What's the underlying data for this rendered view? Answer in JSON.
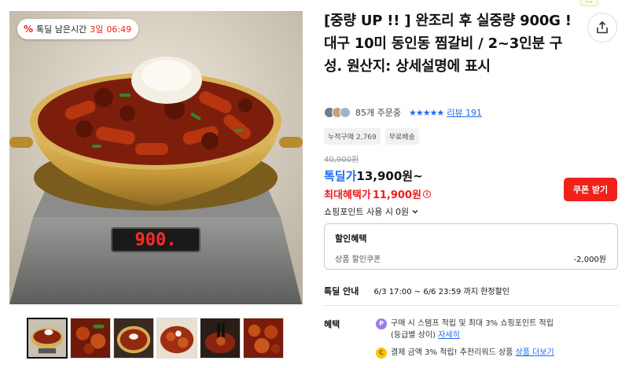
{
  "gallery": {
    "timer": {
      "prefix": "톡딜 남은시간",
      "days": "3일",
      "time": "06:49"
    },
    "scale_display": "900.",
    "thumbnail_count": 6
  },
  "header": {
    "corner_badge": "…"
  },
  "product": {
    "title": "[중량 UP !! ] 완조리 후 실중량 900G ! 대구 10미 동인동 찜갈비 / 2~3인분 구성. 원산지: 상세설명에 표시",
    "order_count": "85개 주문중",
    "stars": "★★★★★",
    "review_link": "리뷰 191",
    "tags": [
      "누적구매 2,769",
      "무료배송"
    ]
  },
  "price": {
    "original": "40,900원",
    "deal_label": "톡딜가",
    "deal_value": "13,900원~",
    "max_label": "최대혜택가",
    "max_value": "11,900원",
    "coupon_button": "쿠폰 받기",
    "points_label": "쇼핑포인트 사용 시",
    "points_value": "0원"
  },
  "discount": {
    "title": "할인혜택",
    "label": "상품 할인쿠폰",
    "value": "-2,000원"
  },
  "deal_info": {
    "label": "톡딜 안내",
    "value": "6/3 17:00 ~ 6/6 23:59 까지 한정할인"
  },
  "benefits": {
    "label": "혜택",
    "items": [
      {
        "icon": "P",
        "text1": "구매 시 스탬프 적립 및 최대 3% 쇼핑포인트 적립",
        "text2": "(등급별 상이)",
        "link": "자세히"
      },
      {
        "icon": "C",
        "text1": "결제 금액 3% 적립! 추천리워드 상품",
        "link": "상품 더보기"
      }
    ]
  },
  "colors": {
    "accent_blue": "#1f6bf0",
    "accent_red": "#f01b1b",
    "coupon_red": "#f0211a"
  }
}
